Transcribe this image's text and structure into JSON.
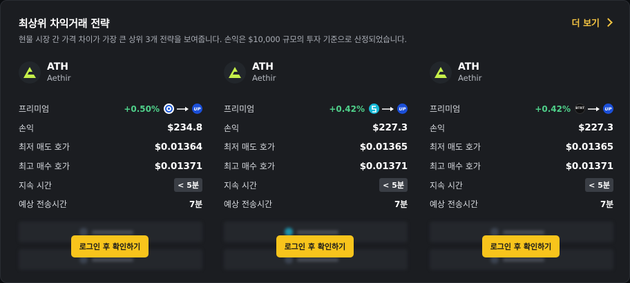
{
  "header": {
    "title": "최상위 차익거래 전략",
    "subtitle": "현물 시장 간 가격 차이가 가장 큰 상위 3개 전략을 보여줍니다. 손익은 $10,000 규모의 투자 기준으로 산정되었습니다.",
    "more_label": "더 보기"
  },
  "labels": {
    "premium": "프리미엄",
    "pnl": "손익",
    "lowest_ask": "최저 매도 호가",
    "highest_bid": "최고 매수 호가",
    "duration": "지속 시간",
    "transfer_time": "예상 전송시간"
  },
  "colors": {
    "accent": "#f6c542",
    "positive": "#4fd08a",
    "button": "#f8c41c"
  },
  "cards": [
    {
      "symbol": "ATH",
      "name": "Aethir",
      "premium": "+0.50%",
      "from_icon": "exchange-icon-white",
      "to_label": "UP",
      "pnl": "$234.8",
      "lowest_ask": "$0.01364",
      "highest_bid": "$0.01371",
      "duration": "< 5분",
      "transfer_time": "7분",
      "button_label": "로그인 후 확인하기"
    },
    {
      "symbol": "ATH",
      "name": "Aethir",
      "premium": "+0.42%",
      "from_icon": "exchange-icon-cyan",
      "to_label": "UP",
      "pnl": "$227.3",
      "lowest_ask": "$0.01365",
      "highest_bid": "$0.01371",
      "duration": "< 5분",
      "transfer_time": "7분",
      "button_label": "로그인 후 확인하기"
    },
    {
      "symbol": "ATH",
      "name": "Aethir",
      "premium": "+0.42%",
      "from_icon": "exchange-icon-black",
      "from_label": "BTRT",
      "to_label": "UP",
      "pnl": "$227.3",
      "lowest_ask": "$0.01365",
      "highest_bid": "$0.01371",
      "duration": "< 5분",
      "transfer_time": "7분",
      "button_label": "로그인 후 확인하기"
    }
  ]
}
